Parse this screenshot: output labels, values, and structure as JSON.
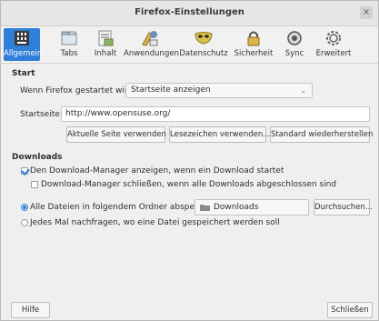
{
  "window": {
    "title": "Firefox-Einstellungen",
    "close_glyph": "×"
  },
  "toolbar": {
    "items": [
      {
        "label": "Allgemein",
        "icon": "general-icon",
        "active": true
      },
      {
        "label": "Tabs",
        "icon": "tabs-icon"
      },
      {
        "label": "Inhalt",
        "icon": "content-icon"
      },
      {
        "label": "Anwendungen",
        "icon": "applications-icon"
      },
      {
        "label": "Datenschutz",
        "icon": "privacy-mask-icon"
      },
      {
        "label": "Sicherheit",
        "icon": "lock-icon"
      },
      {
        "label": "Sync",
        "icon": "sync-icon"
      },
      {
        "label": "Erweitert",
        "icon": "gear-icon"
      }
    ],
    "accent": "#2f7ed8"
  },
  "start": {
    "section_title": "Start",
    "when_label": "Wenn Firefox gestartet wird:",
    "when_value": "Startseite anzeigen",
    "homepage_label": "Startseite:",
    "homepage_value": "http://www.opensuse.org/",
    "btn_current": "Aktuelle Seite verwenden",
    "btn_bookmark": "Lesezeichen verwenden...",
    "btn_restore": "Standard wiederherstellen"
  },
  "downloads": {
    "section_title": "Downloads",
    "show_manager": "Den Download-Manager anzeigen, wenn ein Download startet",
    "close_manager": "Download-Manager schließen, wenn alle Downloads abgeschlossen sind",
    "save_all": "Alle Dateien in folgendem Ordner abspeichern:",
    "folder": "Downloads",
    "browse": "Durchsuchen...",
    "ask_each": "Jedes Mal nachfragen, wo eine Datei gespeichert werden soll"
  },
  "footer": {
    "help": "Hilfe",
    "close": "Schließen"
  }
}
